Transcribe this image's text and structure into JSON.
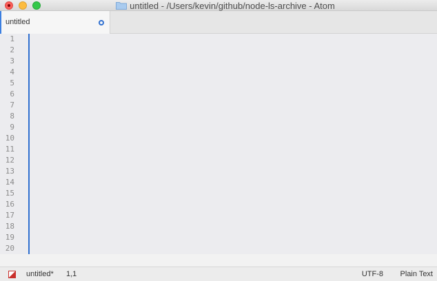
{
  "window": {
    "title": "untitled - /Users/kevin/github/node-ls-archive - Atom"
  },
  "tabs": [
    {
      "label": "untitled",
      "modified": true
    }
  ],
  "editor": {
    "line_numbers": [
      "1",
      "2",
      "3",
      "4",
      "5",
      "6",
      "7",
      "8",
      "9",
      "10",
      "11",
      "12",
      "13",
      "14",
      "15",
      "16",
      "17",
      "18",
      "19",
      "20"
    ]
  },
  "status_bar": {
    "file": "untitled*",
    "cursor_position": "1,1",
    "encoding": "UTF-8",
    "grammar": "Plain Text"
  },
  "colors": {
    "accent": "#2f6fd0",
    "close": "#fc605b",
    "minimize": "#fdbc40",
    "maximize": "#34c84a"
  },
  "icons": [
    "close-icon",
    "minimize-icon",
    "maximize-icon",
    "folder-icon",
    "modified-indicator-icon",
    "git-status-icon"
  ]
}
